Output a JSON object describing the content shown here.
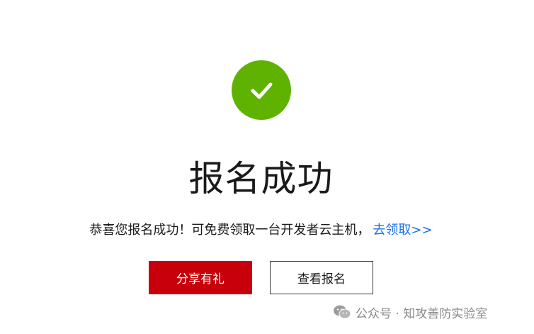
{
  "result": {
    "icon": "checkmark-icon",
    "icon_color": "#5fb300",
    "title": "报名成功"
  },
  "message": {
    "text": "恭喜您报名成功！可免费领取一台开发者云主机，",
    "link": "去领取>>",
    "link_color": "#1a73e8"
  },
  "actions": {
    "share_label": "分享有礼",
    "share_color": "#c7000b",
    "view_label": "查看报名"
  },
  "watermark": {
    "icon": "wechat-icon",
    "text": "公众号 · 知攻善防实验室"
  }
}
